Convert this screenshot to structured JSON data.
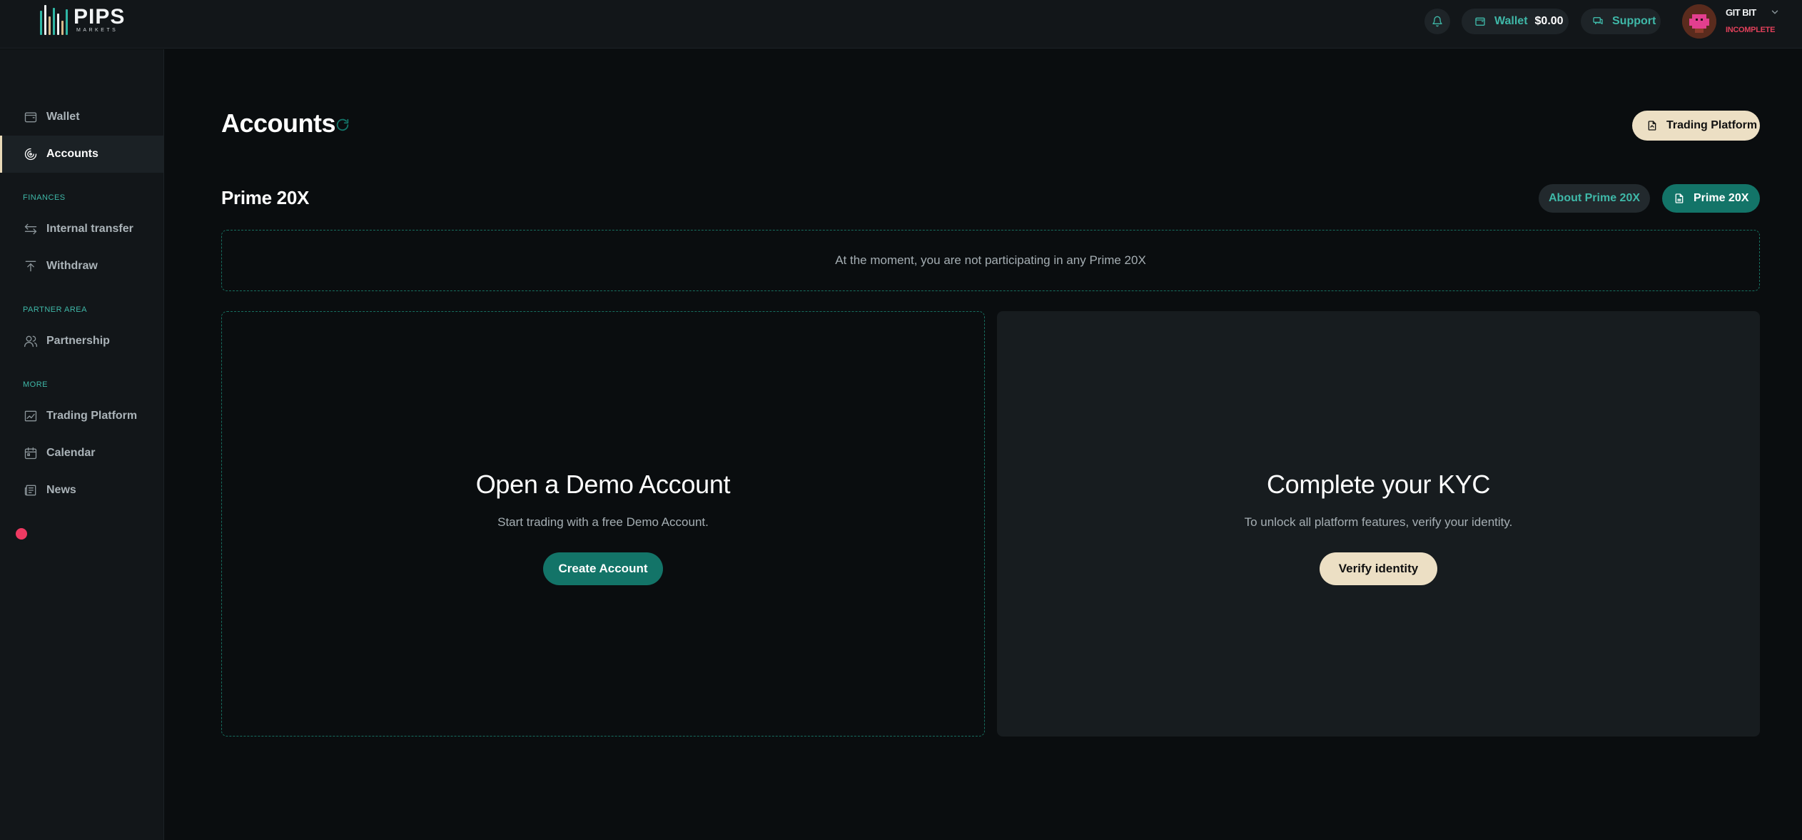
{
  "header": {
    "logo": {
      "main": "PIPS",
      "sub": "MARKETS"
    },
    "wallet": {
      "label": "Wallet",
      "amount": "$0.00"
    },
    "support_label": "Support",
    "user": {
      "name": "GIT BIT",
      "status": "INCOMPLETE"
    }
  },
  "sidebar": {
    "items": [
      {
        "label": "Wallet",
        "icon": "wallet-icon"
      },
      {
        "label": "Accounts",
        "icon": "accounts-icon",
        "active": true
      }
    ],
    "finances_title": "FINANCES",
    "finances": [
      {
        "label": "Internal transfer",
        "icon": "transfer-icon"
      },
      {
        "label": "Withdraw",
        "icon": "withdraw-icon"
      }
    ],
    "partner_title": "PARTNER AREA",
    "partner": [
      {
        "label": "Partnership",
        "icon": "users-icon"
      }
    ],
    "more_title": "MORE",
    "more": [
      {
        "label": "Trading Platform",
        "icon": "chart-icon"
      },
      {
        "label": "Calendar",
        "icon": "calendar-icon"
      },
      {
        "label": "News",
        "icon": "news-icon"
      }
    ]
  },
  "main": {
    "title": "Accounts",
    "trading_platform_label": "Trading Platform",
    "section_title": "Prime 20X",
    "about_label": "About Prime 20X",
    "prime_label": "Prime 20X",
    "notice": "At the moment, you are not participating in any Prime 20X",
    "demo_card": {
      "title": "Open a Demo Account",
      "subtitle": "Start trading with a free Demo Account.",
      "button": "Create Account"
    },
    "kyc_card": {
      "title": "Complete your KYC",
      "subtitle": "To unlock all platform features, verify your identity.",
      "button": "Verify identity"
    }
  },
  "colors": {
    "accent": "#137468",
    "accent_text": "#3fb8a8",
    "cream": "#ecdfc4",
    "notification": "#ee3a62",
    "background": "#0a0d0f",
    "panel": "#121619"
  }
}
